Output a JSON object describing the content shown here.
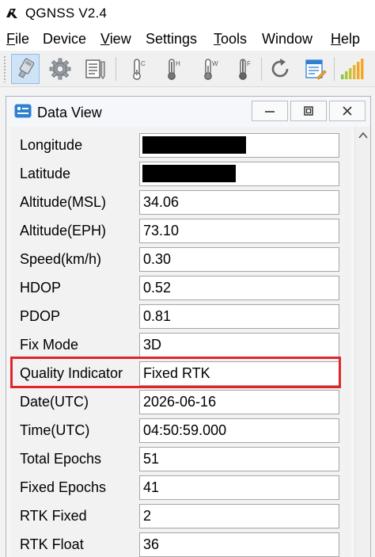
{
  "app": {
    "title": "QGNSS V2.4"
  },
  "menu": [
    {
      "label": "File",
      "accel": "F",
      "rest": "ile"
    },
    {
      "label": "Device",
      "accel": "",
      "rest": "Device"
    },
    {
      "label": "View",
      "accel": "V",
      "rest": "iew"
    },
    {
      "label": "Settings",
      "accel": "",
      "rest": "Settings"
    },
    {
      "label": "Tools",
      "accel": "T",
      "rest": "ools"
    },
    {
      "label": "Window",
      "accel": "",
      "rest": "Window"
    },
    {
      "label": "Help",
      "accel": "H",
      "rest": "elp"
    }
  ],
  "toolbar": {
    "buttons": [
      {
        "icon": "serial-port-icon",
        "active": true
      },
      {
        "icon": "gear-icon"
      },
      {
        "icon": "notes-icon"
      },
      {
        "icon": "thermometer-cold-icon",
        "letter": "C"
      },
      {
        "icon": "thermometer-hot-icon",
        "letter": "H"
      },
      {
        "icon": "thermometer-warm-icon",
        "letter": "W"
      },
      {
        "icon": "thermometer-full-icon",
        "letter": "F"
      },
      {
        "icon": "refresh-icon"
      },
      {
        "icon": "document-edit-icon"
      },
      {
        "icon": "signal-bars-icon"
      }
    ]
  },
  "data_view": {
    "title": "Data View",
    "rows": [
      {
        "label": "Longitude",
        "value": "",
        "redacted": true
      },
      {
        "label": "Latitude",
        "value": "",
        "redacted": true
      },
      {
        "label": "Altitude(MSL)",
        "value": "34.06"
      },
      {
        "label": "Altitude(EPH)",
        "value": "73.10"
      },
      {
        "label": "Speed(km/h)",
        "value": "0.30"
      },
      {
        "label": "HDOP",
        "value": "0.52"
      },
      {
        "label": "PDOP",
        "value": "0.81"
      },
      {
        "label": "Fix Mode",
        "value": "3D"
      },
      {
        "label": "Quality Indicator",
        "value": "Fixed RTK",
        "highlighted": true
      },
      {
        "label": "Date(UTC)",
        "value": "2026-06-16"
      },
      {
        "label": "Time(UTC)",
        "value": "04:50:59.000"
      },
      {
        "label": "Total Epochs",
        "value": "51"
      },
      {
        "label": "Fixed Epochs",
        "value": "41"
      },
      {
        "label": "RTK Fixed",
        "value": "2"
      },
      {
        "label": "RTK Float",
        "value": "36"
      }
    ]
  },
  "colors": {
    "highlight": "#e1252b",
    "toolbar_active": "#cfe3f7",
    "signal_bars": "#f5a623"
  }
}
